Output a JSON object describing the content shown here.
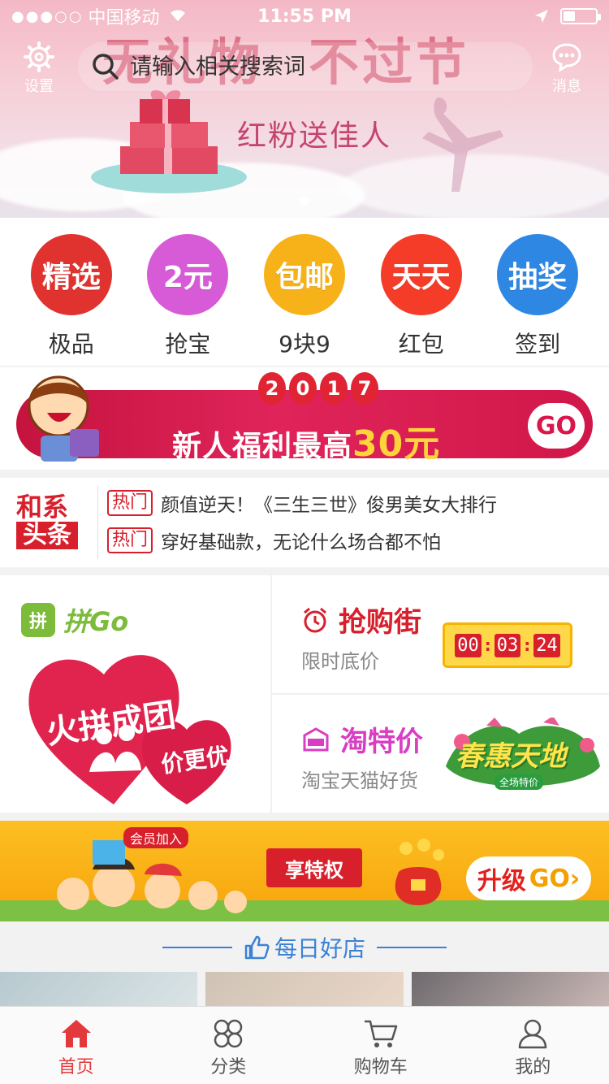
{
  "status_bar": {
    "signal": "●●●○○",
    "carrier": "中国移动",
    "time": "11:55 PM"
  },
  "header": {
    "settings_label": "设置",
    "search_placeholder": "请输入相关搜索词",
    "messages_label": "消息"
  },
  "banner": {
    "headline_part1": "无礼物",
    "headline_part2": "不过节",
    "subline": "红粉送佳人"
  },
  "quick_entries": [
    {
      "circle_text": "精选",
      "label": "极品",
      "color": "#e0322e"
    },
    {
      "circle_text": "2元",
      "label": "抢宝",
      "color": "#d75ad6"
    },
    {
      "circle_text": "包邮",
      "label": "9块9",
      "color": "#f7b21a"
    },
    {
      "circle_text": "天天",
      "label": "红包",
      "color": "#f43c29"
    },
    {
      "circle_text": "抽奖",
      "label": "签到",
      "color": "#2f87e4"
    }
  ],
  "promo": {
    "year_digits": [
      "2",
      "0",
      "1",
      "7"
    ],
    "text": "新人福利最高",
    "amount": "30元",
    "go": "GO"
  },
  "news": {
    "logo_line1": "和系",
    "logo_line2": "头条",
    "items": [
      {
        "tag": "热门",
        "text": "颜值逆天！《三生三世》俊男美女大排行"
      },
      {
        "tag": "热门",
        "text": "穿好基础款，无论什么场合都不怕"
      }
    ]
  },
  "pingo": {
    "icon_text": "拼",
    "name": "拼Go",
    "heart_text1": "火拼成团",
    "heart_text2": "价更优"
  },
  "flash_sale": {
    "title": "抢购街",
    "subtitle": "限时底价",
    "countdown": {
      "h": "00",
      "m": "03",
      "s": "24"
    }
  },
  "taote": {
    "title": "淘特价",
    "subtitle": "淘宝天猫好货",
    "art_text": "春惠天地",
    "art_sub": "全场特价"
  },
  "vip": {
    "tag": "会员加入",
    "ribbon": "享特权",
    "button_text": "升级",
    "button_go": "GO›"
  },
  "daily": {
    "title": "每日好店"
  },
  "tabbar": [
    {
      "label": "首页",
      "active": true
    },
    {
      "label": "分类",
      "active": false
    },
    {
      "label": "购物车",
      "active": false
    },
    {
      "label": "我的",
      "active": false
    }
  ]
}
